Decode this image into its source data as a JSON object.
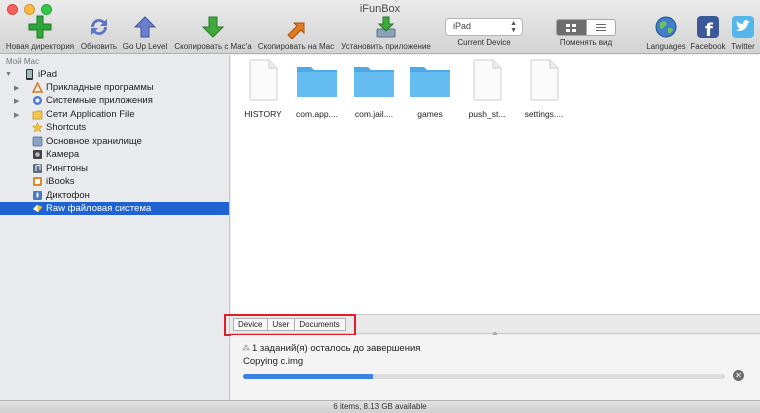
{
  "window": {
    "title": "iFunBox"
  },
  "toolbar": {
    "new_folder": "Новая директория",
    "refresh": "Обновить",
    "go_up": "Go Up Level",
    "copy_to_mac_a": "Скопировать с Mac'а",
    "copy_to_mac": "Скопировать на Mac",
    "install_app": "Установить приложение",
    "current_device_label": "Current Device",
    "device_value": "iPad",
    "change_view": "Поменять вид",
    "languages": "Languages",
    "facebook": "Facebook",
    "twitter": "Twitter"
  },
  "sidebar": {
    "header": "Мой Mac",
    "device": "iPad",
    "items": [
      {
        "label": "Прикладные программы",
        "icon": "app-store-icon"
      },
      {
        "label": "Системные приложения",
        "icon": "system-apps-icon"
      },
      {
        "label": "Сети Application File",
        "icon": "app-file-icon"
      },
      {
        "label": "Shortcuts",
        "icon": "star-icon"
      },
      {
        "label": "Основное хранилище",
        "icon": "storage-icon"
      },
      {
        "label": "Камера",
        "icon": "camera-icon"
      },
      {
        "label": "Рингтоны",
        "icon": "ringtone-icon"
      },
      {
        "label": "iBooks",
        "icon": "ibooks-icon"
      },
      {
        "label": "Диктофон",
        "icon": "dictaphone-icon"
      },
      {
        "label": "Raw файловая система",
        "icon": "raw-fs-icon"
      }
    ]
  },
  "files": [
    {
      "name": "HISTORY",
      "kind": "document"
    },
    {
      "name": "com.app....",
      "kind": "folder"
    },
    {
      "name": "com.jail....",
      "kind": "folder"
    },
    {
      "name": "games",
      "kind": "folder"
    },
    {
      "name": "push_st...",
      "kind": "document"
    },
    {
      "name": "settings....",
      "kind": "document"
    }
  ],
  "breadcrumb": [
    "Device",
    "User",
    "Documents"
  ],
  "task": {
    "status": "1 заданий(я) осталось до завершения",
    "current": "Copying c.img",
    "progress": 0.27
  },
  "status_bar": {
    "text": "6 items, 8.13 GB available"
  },
  "colors": {
    "selection": "#1e63d1",
    "progress": "#3b82e4",
    "highlight_box": "#e21d2b",
    "folder": "#5db7ee"
  }
}
